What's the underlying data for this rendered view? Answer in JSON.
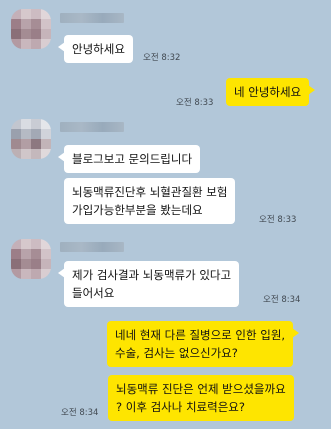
{
  "colors": {
    "background": "#b2c7d9",
    "incoming_bubble": "#ffffff",
    "outgoing_bubble": "#fee500"
  },
  "messages": [
    {
      "text": "안녕하세요",
      "time": "오전 8:32"
    },
    {
      "text": "네 안녕하세요",
      "time": "오전 8:33"
    },
    {
      "text": "블로그보고 문의드립니다"
    },
    {
      "lines": [
        "뇌동맥류진단후 뇌혈관질환 보험",
        "가입가능한부분을 봤는데요"
      ],
      "time": "오전 8:33"
    },
    {
      "lines": [
        "제가 검사결과 뇌동맥류가 있다고",
        "들어서요"
      ],
      "time": "오전 8:34"
    },
    {
      "lines": [
        "네네 현재 다른 질병으로 인한 입원,",
        "수술, 검사는 없으신가요?"
      ]
    },
    {
      "lines": [
        "뇌동맥류 진단은 언제 받으셨을까요",
        "? 이후 검사나 치료력은요?"
      ],
      "time": "오전 8:34"
    }
  ]
}
